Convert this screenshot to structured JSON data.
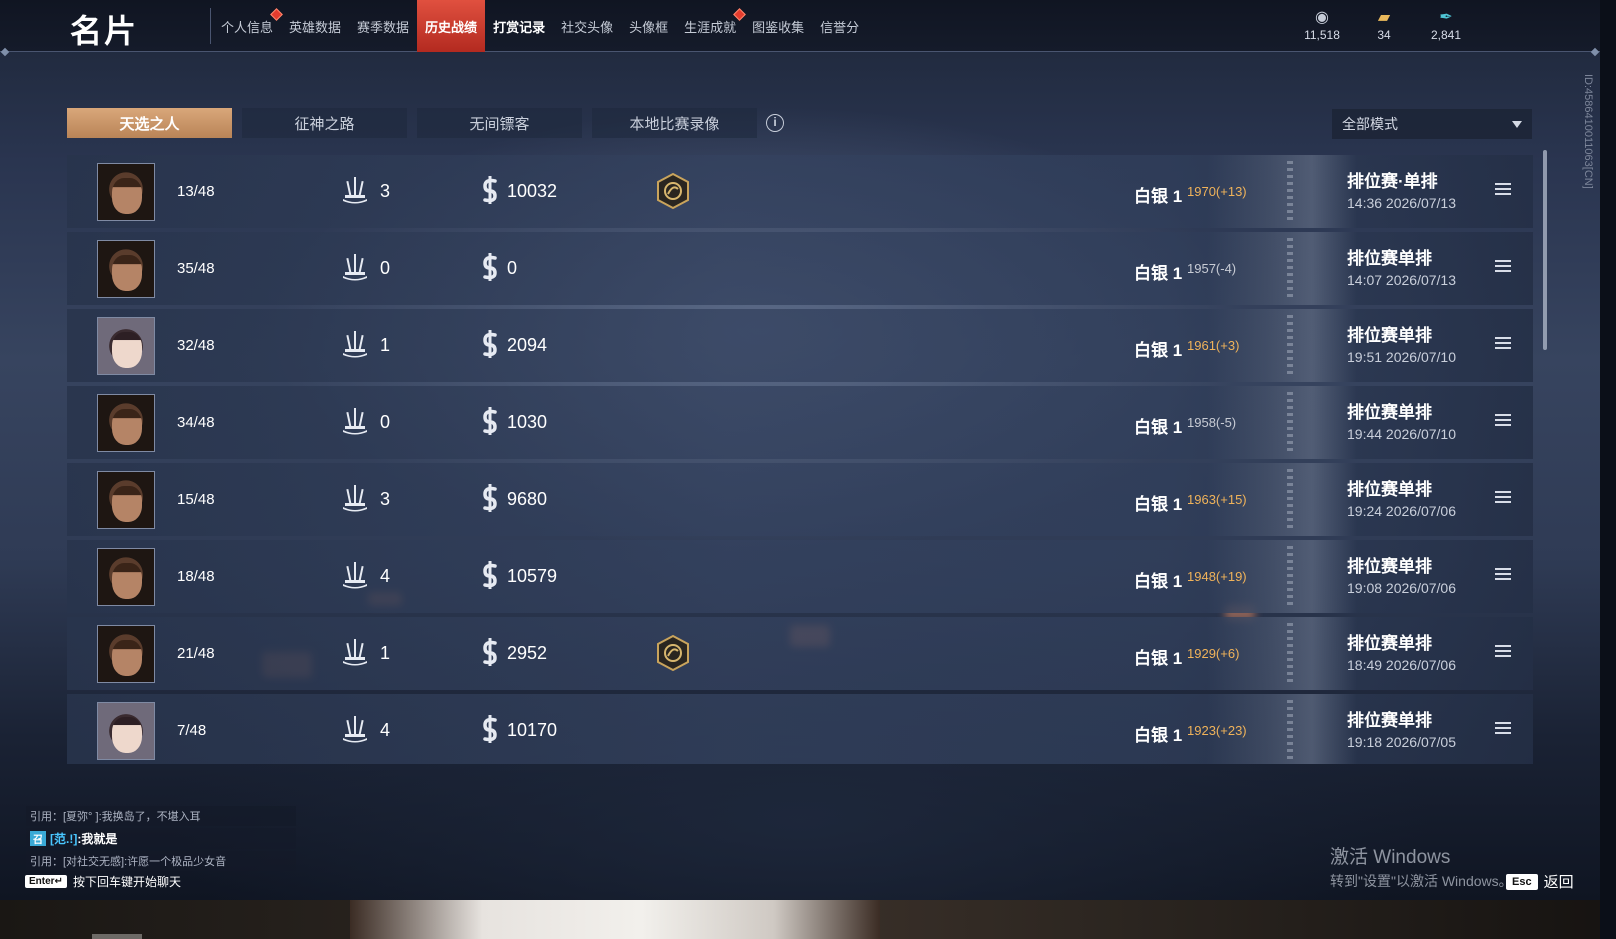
{
  "header": {
    "title": "名片",
    "nav": [
      {
        "label": "个人信息",
        "dot": true,
        "active": false,
        "bold": false
      },
      {
        "label": "英雄数据",
        "dot": false,
        "active": false,
        "bold": false
      },
      {
        "label": "赛季数据",
        "dot": false,
        "active": false,
        "bold": false
      },
      {
        "label": "历史战绩",
        "dot": false,
        "active": true,
        "bold": true
      },
      {
        "label": "打赏记录",
        "dot": false,
        "active": false,
        "bold": true
      },
      {
        "label": "社交头像",
        "dot": false,
        "active": false,
        "bold": false
      },
      {
        "label": "头像框",
        "dot": false,
        "active": false,
        "bold": false
      },
      {
        "label": "生涯成就",
        "dot": true,
        "active": false,
        "bold": false
      },
      {
        "label": "图鉴收集",
        "dot": false,
        "active": false,
        "bold": false
      },
      {
        "label": "信誉分",
        "dot": false,
        "active": false,
        "bold": false
      }
    ],
    "currencies": [
      {
        "icon": "silver-coin-icon",
        "value": "11,518"
      },
      {
        "icon": "gold-ticket-icon",
        "value": "34"
      },
      {
        "icon": "feather-icon",
        "value": "2,841"
      }
    ]
  },
  "tabs": [
    {
      "label": "天选之人",
      "active": true
    },
    {
      "label": "征神之路",
      "active": false
    },
    {
      "label": "无间镖客",
      "active": false
    },
    {
      "label": "本地比赛录像",
      "active": false
    }
  ],
  "info_glyph": "i",
  "mode_filter": {
    "value": "全部模式"
  },
  "matches": [
    {
      "avatar": "male",
      "rank": "13/48",
      "kills": "3",
      "coins": "10032",
      "badge": true,
      "tier": "白银 1",
      "score": "1970(+13)",
      "trend": "up",
      "mode": "排位赛·单排",
      "time": "14:36 2026/07/13"
    },
    {
      "avatar": "male",
      "rank": "35/48",
      "kills": "0",
      "coins": "0",
      "badge": false,
      "tier": "白银 1",
      "score": "1957(-4)",
      "trend": "down",
      "mode": "排位赛单排",
      "time": "14:07 2026/07/13"
    },
    {
      "avatar": "female",
      "rank": "32/48",
      "kills": "1",
      "coins": "2094",
      "badge": false,
      "tier": "白银 1",
      "score": "1961(+3)",
      "trend": "up",
      "mode": "排位赛单排",
      "time": "19:51 2026/07/10"
    },
    {
      "avatar": "male",
      "rank": "34/48",
      "kills": "0",
      "coins": "1030",
      "badge": false,
      "tier": "白银 1",
      "score": "1958(-5)",
      "trend": "down",
      "mode": "排位赛单排",
      "time": "19:44 2026/07/10"
    },
    {
      "avatar": "male",
      "rank": "15/48",
      "kills": "3",
      "coins": "9680",
      "badge": false,
      "tier": "白银 1",
      "score": "1963(+15)",
      "trend": "up",
      "mode": "排位赛单排",
      "time": "19:24 2026/07/06"
    },
    {
      "avatar": "male",
      "rank": "18/48",
      "kills": "4",
      "coins": "10579",
      "badge": false,
      "tier": "白银 1",
      "score": "1948(+19)",
      "trend": "up",
      "mode": "排位赛单排",
      "time": "19:08 2026/07/06"
    },
    {
      "avatar": "male",
      "rank": "21/48",
      "kills": "1",
      "coins": "2952",
      "badge": true,
      "tier": "白银 1",
      "score": "1929(+6)",
      "trend": "up",
      "mode": "排位赛单排",
      "time": "18:49 2026/07/06"
    },
    {
      "avatar": "female",
      "rank": "7/48",
      "kills": "4",
      "coins": "10170",
      "badge": false,
      "tier": "白银 1",
      "score": "1923(+23)",
      "trend": "up",
      "mode": "排位赛单排",
      "time": "19:18 2026/07/05"
    }
  ],
  "side_id": "ID:4586410011063[CN]",
  "chat": {
    "lines": [
      {
        "text": "引用：[夏弥°  ]:我换岛了，不堪入耳",
        "me": false
      },
      {
        "tag": "召",
        "nick": "[范.!]",
        "text": ":我就是",
        "me": true
      },
      {
        "text": "引用：[对社交无感]:许愿一个极品少女音",
        "me": false
      }
    ],
    "enter_key": "Enter↵",
    "hint": "按下回车键开始聊天"
  },
  "watermark": {
    "line1": "激活 Windows",
    "line2": "转到\"设置\"以激活 Windows。"
  },
  "back": {
    "key": "Esc",
    "label": "返回"
  },
  "colors": {
    "accent_red": "#d8402f",
    "tab_active": "#c99467",
    "score_up": "#f0b35a",
    "nick": "#49c7ff"
  }
}
